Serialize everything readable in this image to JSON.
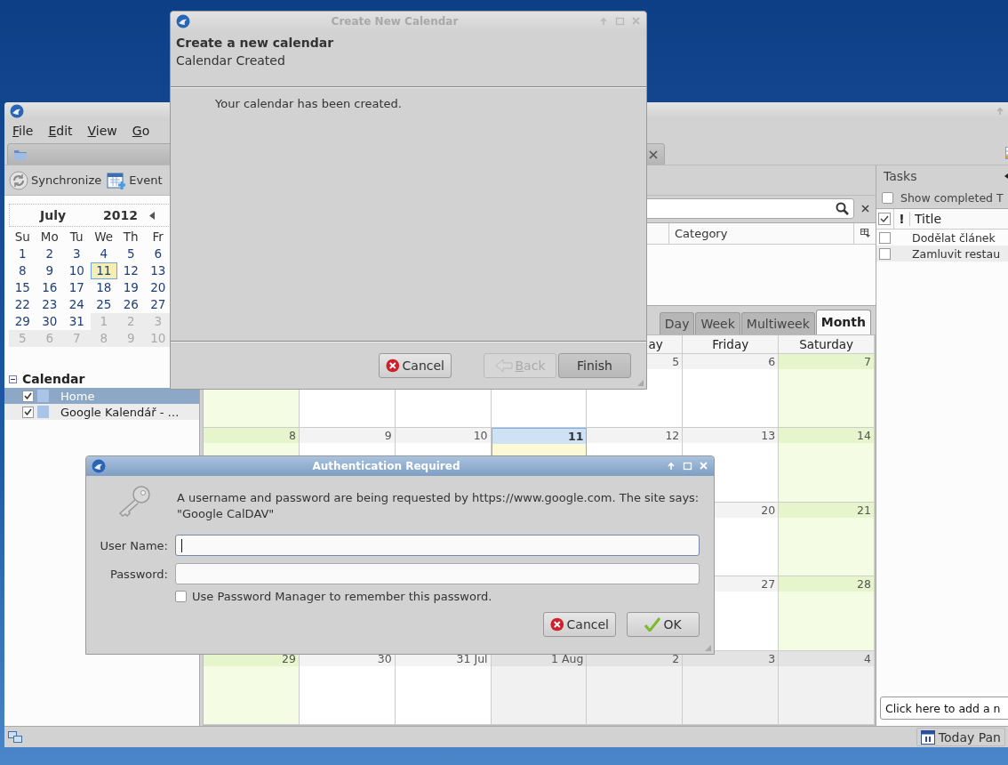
{
  "main_window": {
    "menu": [
      {
        "label": "File"
      },
      {
        "label": "Edit"
      },
      {
        "label": "View"
      },
      {
        "label": "Go"
      }
    ],
    "toolbar": [
      {
        "label": "Synchronize",
        "kind": "sync"
      },
      {
        "label": "Event",
        "kind": "event"
      }
    ],
    "mini_calendar": {
      "month": "July",
      "year": "2012",
      "weekdays": [
        "Su",
        "Mo",
        "Tu",
        "We",
        "Th",
        "Fr"
      ],
      "weeks": [
        [
          {
            "label": "1",
            "kind": "current"
          },
          {
            "label": "2",
            "kind": "current"
          },
          {
            "label": "3",
            "kind": "current"
          },
          {
            "label": "4",
            "kind": "current"
          },
          {
            "label": "5",
            "kind": "current"
          },
          {
            "label": "6",
            "kind": "current"
          }
        ],
        [
          {
            "label": "8",
            "kind": "current"
          },
          {
            "label": "9",
            "kind": "current"
          },
          {
            "label": "10",
            "kind": "current"
          },
          {
            "label": "11",
            "kind": "today"
          },
          {
            "label": "12",
            "kind": "current"
          },
          {
            "label": "13",
            "kind": "current"
          }
        ],
        [
          {
            "label": "15",
            "kind": "current"
          },
          {
            "label": "16",
            "kind": "current"
          },
          {
            "label": "17",
            "kind": "current"
          },
          {
            "label": "18",
            "kind": "current"
          },
          {
            "label": "19",
            "kind": "current"
          },
          {
            "label": "20",
            "kind": "current"
          }
        ],
        [
          {
            "label": "22",
            "kind": "current"
          },
          {
            "label": "23",
            "kind": "current"
          },
          {
            "label": "24",
            "kind": "current"
          },
          {
            "label": "25",
            "kind": "current"
          },
          {
            "label": "26",
            "kind": "current"
          },
          {
            "label": "27",
            "kind": "current"
          }
        ],
        [
          {
            "label": "29",
            "kind": "current"
          },
          {
            "label": "30",
            "kind": "current"
          },
          {
            "label": "31",
            "kind": "current"
          },
          {
            "label": "1",
            "kind": "other"
          },
          {
            "label": "2",
            "kind": "other"
          },
          {
            "label": "3",
            "kind": "other"
          }
        ],
        [
          {
            "label": "5",
            "kind": "other"
          },
          {
            "label": "6",
            "kind": "other"
          },
          {
            "label": "7",
            "kind": "other"
          },
          {
            "label": "8",
            "kind": "other"
          },
          {
            "label": "9",
            "kind": "other"
          },
          {
            "label": "10",
            "kind": "other"
          }
        ]
      ]
    },
    "calendar_list": {
      "title": "Calendar",
      "expanded": true,
      "items": [
        {
          "name": "Home",
          "checked": true,
          "selected": true,
          "color": "#a9c4e6"
        },
        {
          "name": "Google Kalendář - …",
          "checked": true,
          "selected": false,
          "color": "#a9c4e6"
        }
      ]
    },
    "list_columns": [
      "Category"
    ],
    "view_tabs": [
      {
        "label": "Day",
        "selected": false
      },
      {
        "label": "Week",
        "selected": false
      },
      {
        "label": "Multiweek",
        "selected": false
      },
      {
        "label": "Month",
        "selected": true
      }
    ],
    "month_view": {
      "headers": [
        "ay",
        "Friday",
        "Saturday"
      ],
      "weeks": [
        [
          {
            "kind": "weekend"
          },
          {
            "kind": "weekday"
          },
          {
            "kind": "weekday"
          },
          {
            "kind": "weekday"
          },
          {
            "label": "5",
            "kind": "weekday"
          },
          {
            "label": "6",
            "kind": "weekday"
          },
          {
            "label": "7",
            "kind": "weekend"
          }
        ],
        [
          {
            "label": "8",
            "kind": "weekend"
          },
          {
            "label": "9",
            "kind": "weekday"
          },
          {
            "label": "10",
            "kind": "weekday"
          },
          {
            "label": "11",
            "kind": "today"
          },
          {
            "label": "12",
            "kind": "weekday"
          },
          {
            "label": "13",
            "kind": "weekday"
          },
          {
            "label": "14",
            "kind": "weekend"
          }
        ],
        [
          {
            "label": "20",
            "kind": "weekday"
          },
          {
            "label": "21",
            "kind": "weekend"
          }
        ],
        [
          {
            "label": "27",
            "kind": "weekday"
          },
          {
            "label": "28",
            "kind": "weekend"
          }
        ],
        [
          {
            "label": "29",
            "kind": "weekend"
          },
          {
            "label": "30",
            "kind": "weekday"
          },
          {
            "label": "31 Jul",
            "kind": "weekday"
          },
          {
            "label": "1 Aug",
            "kind": "other"
          },
          {
            "label": "2",
            "kind": "other"
          },
          {
            "label": "3",
            "kind": "other"
          },
          {
            "label": "4",
            "kind": "other"
          }
        ]
      ]
    },
    "tasks": {
      "title": "Tasks",
      "show_completed": {
        "label": "Show completed T",
        "checked": false
      },
      "priority_column": "!",
      "title_column": "Title",
      "rows": [
        {
          "title": "Dodělat článek",
          "completed": false
        },
        {
          "title": "Zamluvit restau",
          "completed": false
        }
      ],
      "new_task_placeholder": "Click here to add a n"
    },
    "status_bar": {
      "today_pane": "Today Pan"
    }
  },
  "create_dialog": {
    "title": "Create New Calendar",
    "active": false,
    "heading": "Create a new calendar",
    "subheading": "Calendar Created",
    "message": "Your calendar has been created.",
    "buttons": [
      {
        "label": "Cancel",
        "kind": "cancel",
        "disabled": false
      },
      {
        "label": "Back",
        "kind": "back",
        "disabled": true
      },
      {
        "label": "Finish",
        "kind": "plain",
        "disabled": false
      }
    ]
  },
  "auth_dialog": {
    "title": "Authentication Required",
    "active": true,
    "message": "A username and password are being requested by https://www.google.com. The site says: \"Google CalDAV\"",
    "fields": [
      {
        "label": "User Name:",
        "focused": true
      },
      {
        "label": "Password:",
        "focused": false
      }
    ],
    "remember": {
      "label": "Use Password Manager to remember this password.",
      "checked": false
    },
    "buttons": [
      {
        "label": "Cancel",
        "kind": "cancel"
      },
      {
        "label": "OK",
        "kind": "ok"
      }
    ]
  }
}
